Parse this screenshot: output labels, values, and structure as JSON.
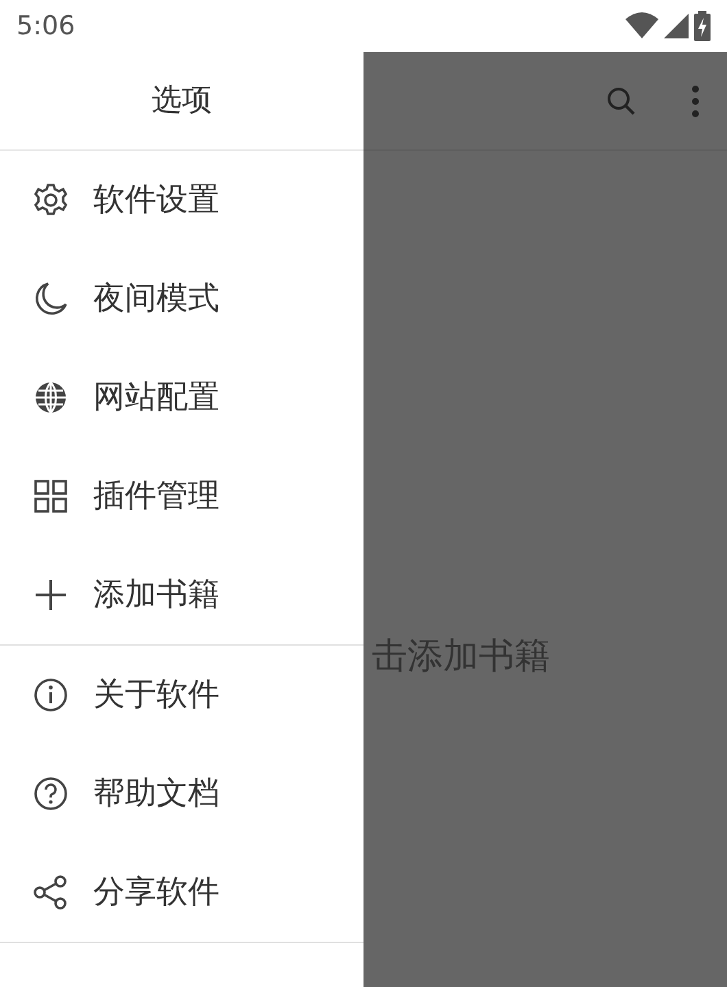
{
  "status_bar": {
    "time": "5:06"
  },
  "drawer": {
    "title": "选项",
    "groups": [
      {
        "items": [
          {
            "kind": "gear",
            "label": "软件设置"
          },
          {
            "kind": "moon",
            "label": "夜间模式"
          },
          {
            "kind": "globe",
            "label": "网站配置"
          },
          {
            "kind": "grid",
            "label": "插件管理"
          },
          {
            "kind": "plus",
            "label": "添加书籍"
          }
        ]
      },
      {
        "items": [
          {
            "kind": "info",
            "label": "关于软件"
          },
          {
            "kind": "help",
            "label": "帮助文档"
          },
          {
            "kind": "share",
            "label": "分享软件"
          }
        ]
      }
    ]
  },
  "content": {
    "empty_hint": "击添加书籍"
  }
}
